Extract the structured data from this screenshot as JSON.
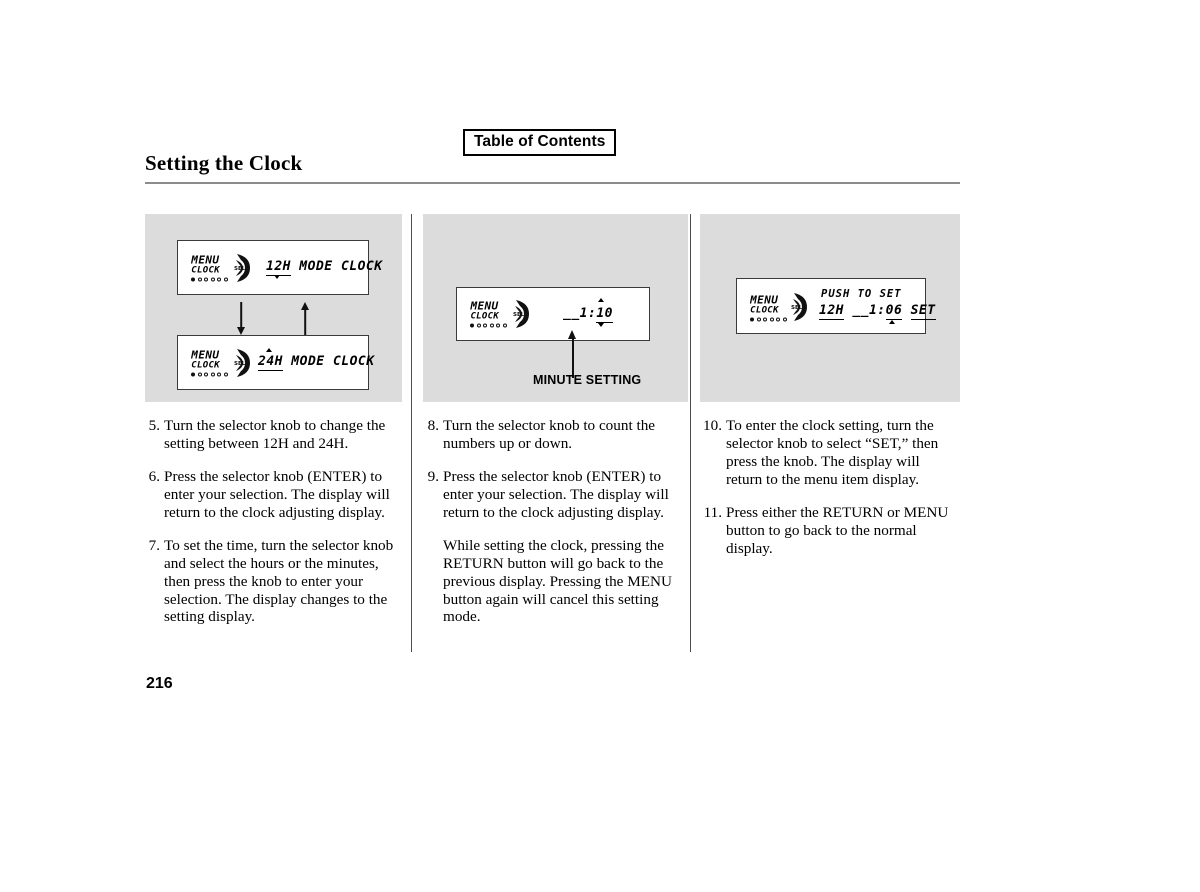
{
  "header": {
    "toc_label": "Table of Contents",
    "page_title": "Setting the Clock"
  },
  "page_number": "216",
  "panels": [
    {
      "name": "12h-24h-mode-panel",
      "displays": [
        {
          "id": "lcd-12h",
          "menu_label": "MENU",
          "clock_label": "CLOCK",
          "knob_label": "SEL",
          "indicator_dots": 6,
          "indicator_active": 1,
          "main_text": "12H MODE CLOCK",
          "highlight": "12H",
          "marker": "down"
        },
        {
          "id": "lcd-24h",
          "menu_label": "MENU",
          "clock_label": "CLOCK",
          "knob_label": "SEL",
          "indicator_dots": 6,
          "indicator_active": 1,
          "main_text": "24H MODE CLOCK",
          "highlight": "24H",
          "marker": "up"
        }
      ],
      "flow_arrows": [
        "down",
        "up"
      ]
    },
    {
      "name": "minute-setting-panel",
      "displays": [
        {
          "id": "lcd-minute",
          "menu_label": "MENU",
          "clock_label": "CLOCK",
          "knob_label": "SEL",
          "indicator_dots": 6,
          "indicator_active": 1,
          "main_text": "__1:10",
          "hour_part": "__1:",
          "minute_part": "10",
          "marker": "both"
        }
      ],
      "callout": "MINUTE SETTING"
    },
    {
      "name": "push-to-set-panel",
      "displays": [
        {
          "id": "lcd-set",
          "menu_label": "MENU",
          "clock_label": "CLOCK",
          "knob_label": "SEL",
          "indicator_dots": 6,
          "indicator_active": 1,
          "top_text": "PUSH TO SET",
          "main_text": "12H __1:06 SET",
          "segments": [
            "12H",
            "__1:",
            "06",
            "SET"
          ],
          "marker": "up"
        }
      ]
    }
  ],
  "columns": [
    {
      "steps": [
        {
          "number": "5.",
          "paragraphs": [
            "Turn the selector knob to change the setting between 12H and 24H."
          ]
        },
        {
          "number": "6.",
          "paragraphs": [
            "Press the selector knob (ENTER) to enter your selection. The display will return to the clock adjusting display."
          ]
        },
        {
          "number": "7.",
          "paragraphs": [
            "To set the time, turn the selector knob and select the hours or the minutes, then press the knob to enter your selection. The display changes to the setting display."
          ]
        }
      ]
    },
    {
      "steps": [
        {
          "number": "8.",
          "paragraphs": [
            "Turn the selector knob to count the numbers up or down."
          ]
        },
        {
          "number": "9.",
          "paragraphs": [
            "Press the selector knob (ENTER) to enter your selection. The display will return to the clock adjusting display.",
            "While setting the clock, pressing the RETURN button will go back to the previous display. Pressing the MENU button again will cancel this setting mode."
          ]
        }
      ]
    },
    {
      "steps": [
        {
          "number": "10.",
          "paragraphs": [
            "To enter the clock setting, turn the selector knob to select “SET,” then press the knob. The display will return to the menu item display."
          ]
        },
        {
          "number": "11.",
          "paragraphs": [
            "Press either the RETURN or MENU button to go back to the normal display."
          ]
        }
      ]
    }
  ],
  "colors": {
    "panel_background": "#dcdcdc",
    "rule": "#8c8c8c",
    "text": "#000000"
  }
}
